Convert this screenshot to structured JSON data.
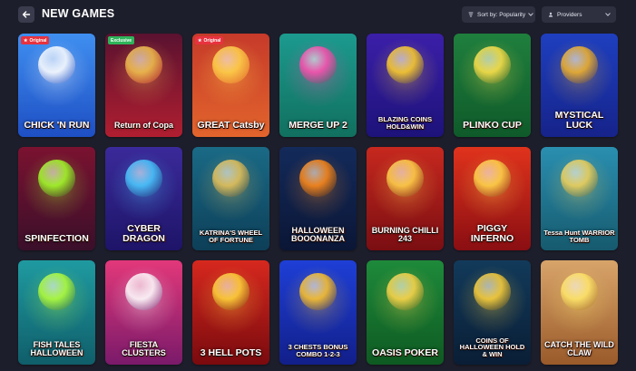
{
  "header": {
    "title": "NEW GAMES",
    "sort_label": "Sort by: Popularity",
    "providers_label": "Providers"
  },
  "games": [
    {
      "name": "CHICK 'N RUN",
      "badge": "Original",
      "badge_type": "orig",
      "bg_top": "#3f8ff0",
      "bg_bottom": "#1e4fc4",
      "accent": "#ffffff"
    },
    {
      "name": "Return of Copa",
      "badge": "Exclusive",
      "badge_type": "excl",
      "bg_top": "#5a1230",
      "bg_bottom": "#b01e30",
      "accent": "#f2c14e"
    },
    {
      "name": "GREAT Catsby",
      "badge": "Original",
      "badge_type": "orig",
      "bg_top": "#c63a2a",
      "bg_bottom": "#e2642c",
      "accent": "#ffd34a"
    },
    {
      "name": "MERGE UP 2",
      "badge": "",
      "badge_type": "",
      "bg_top": "#1c9a8e",
      "bg_bottom": "#11705f",
      "accent": "#ff4fb0"
    },
    {
      "name": "BLAZING COINS HOLD&WIN",
      "badge": "",
      "badge_type": "",
      "bg_top": "#3b1fa8",
      "bg_bottom": "#1d127a",
      "accent": "#ffcf2a"
    },
    {
      "name": "PLINKO CUP",
      "badge": "",
      "badge_type": "",
      "bg_top": "#1f7f3d",
      "bg_bottom": "#0f5a2a",
      "accent": "#ffe14a"
    },
    {
      "name": "MYSTICAL LUCK",
      "badge": "",
      "badge_type": "",
      "bg_top": "#1e3fbf",
      "bg_bottom": "#16238a",
      "accent": "#f3b32a"
    },
    {
      "name": "SPINFECTION",
      "badge": "",
      "badge_type": "",
      "bg_top": "#7a1230",
      "bg_bottom": "#3a0f2a",
      "accent": "#a4ff2a"
    },
    {
      "name": "CYBER DRAGON",
      "badge": "",
      "badge_type": "",
      "bg_top": "#3a2a9a",
      "bg_bottom": "#1e1468",
      "accent": "#4ac8ff"
    },
    {
      "name": "KATRINA'S WHEEL OF FORTUNE",
      "badge": "",
      "badge_type": "",
      "bg_top": "#1a6a86",
      "bg_bottom": "#0d3f58",
      "accent": "#e8c35a"
    },
    {
      "name": "HALLOWEEN BOOONANZA",
      "badge": "",
      "badge_type": "",
      "bg_top": "#132a5a",
      "bg_bottom": "#0b1636",
      "accent": "#ff8a1a"
    },
    {
      "name": "BURNING CHILLI 243",
      "badge": "",
      "badge_type": "",
      "bg_top": "#c6281e",
      "bg_bottom": "#7a0e12",
      "accent": "#ffd24a"
    },
    {
      "name": "PIGGY INFERNO",
      "badge": "",
      "badge_type": "",
      "bg_top": "#e0331c",
      "bg_bottom": "#8a0e12",
      "accent": "#ffd64a"
    },
    {
      "name": "Tessa Hunt WARRIOR TOMB",
      "badge": "",
      "badge_type": "",
      "bg_top": "#2a8fb0",
      "bg_bottom": "#165a6e",
      "accent": "#f2d25a"
    },
    {
      "name": "FISH TALES HALLOWEEN",
      "badge": "",
      "badge_type": "",
      "bg_top": "#1f9aa0",
      "bg_bottom": "#0f5e6a",
      "accent": "#b4ff3a"
    },
    {
      "name": "FIESTA CLUSTERS",
      "badge": "",
      "badge_type": "",
      "bg_top": "#e2387a",
      "bg_bottom": "#7a1a6a",
      "accent": "#ffffff"
    },
    {
      "name": "3 HELL POTS",
      "badge": "",
      "badge_type": "",
      "bg_top": "#d6281e",
      "bg_bottom": "#7a0a0e",
      "accent": "#ffd43a"
    },
    {
      "name": "3 CHESTS BONUS COMBO 1-2-3",
      "badge": "",
      "badge_type": "",
      "bg_top": "#1e3fd6",
      "bg_bottom": "#121f8a",
      "accent": "#ffc42a"
    },
    {
      "name": "OASIS POKER",
      "badge": "",
      "badge_type": "",
      "bg_top": "#1e8a3a",
      "bg_bottom": "#0e5a22",
      "accent": "#ffd64a"
    },
    {
      "name": "COINS OF HALLOWEEN HOLD & WIN",
      "badge": "",
      "badge_type": "",
      "bg_top": "#123a5a",
      "bg_bottom": "#0a1e36",
      "accent": "#ffd23a"
    },
    {
      "name": "CATCH THE WILD CLAW",
      "badge": "",
      "badge_type": "",
      "bg_top": "#d8a46a",
      "bg_bottom": "#9a5a2a",
      "accent": "#ffe66a"
    }
  ]
}
